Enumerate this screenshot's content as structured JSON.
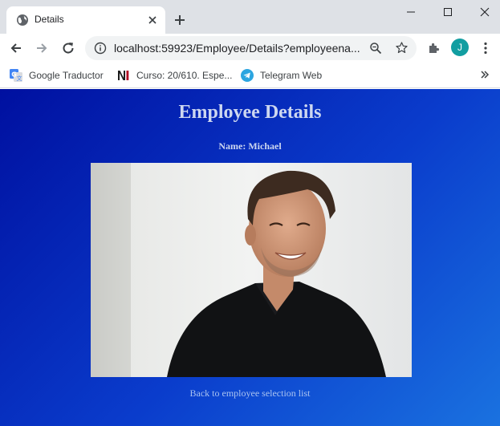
{
  "browser": {
    "tab": {
      "title": "Details",
      "favicon": "globe-icon"
    },
    "address_bar": {
      "url": "localhost:59923/Employee/Details?employeena..."
    },
    "profile": {
      "initial": "J",
      "color": "#129ea1"
    },
    "bookmarks": [
      {
        "label": "Google Traductor",
        "icon": "google-translate-icon"
      },
      {
        "label": "Curso: 20/610. Espe...",
        "icon": "ni-logo-icon"
      },
      {
        "label": "Telegram Web",
        "icon": "telegram-icon"
      }
    ]
  },
  "page": {
    "title": "Employee Details",
    "name_line": "Name: Michael",
    "photo": {
      "subject": "smiling man in black shirt"
    },
    "back_link": "Back to employee selection list"
  },
  "colors": {
    "tabstrip_bg": "#dee1e6",
    "page_gradient_start": "#0010a0",
    "page_gradient_end": "#1a72e0",
    "heading_text": "#cdd7f0",
    "link_text": "#aac3f0"
  }
}
